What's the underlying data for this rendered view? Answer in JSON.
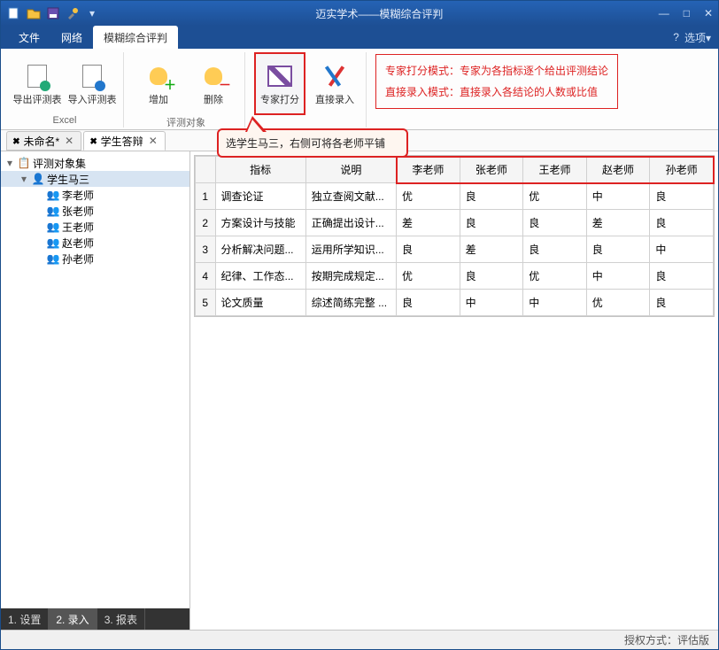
{
  "title": "迈实学术——模糊综合评判",
  "sysbuttons": {
    "min": "—",
    "max": "□",
    "close": "✕"
  },
  "menus": {
    "file": "文件",
    "net": "网络",
    "fuzzy": "模糊综合评判"
  },
  "right_menu": {
    "help": "?",
    "options": "选项▾"
  },
  "ribbon": {
    "excel": {
      "label": "Excel",
      "export": "导出评测表",
      "import": "导入评测表"
    },
    "subject": {
      "label": "评测对象",
      "add": "增加",
      "del": "删除"
    },
    "expert": "专家打分",
    "direct": "直接录入",
    "info_line1": "专家打分模式：专家为各指标逐个给出评测结论",
    "info_line2": "直接录入模式：直接录入各结论的人数或比值"
  },
  "callout_text": "选学生马三，右侧可将各老师平铺",
  "doctabs": {
    "tab1": "未命名*",
    "tab2": "学生答辩"
  },
  "tree": {
    "root": "评测对象集",
    "student": "学生马三",
    "teachers": [
      "李老师",
      "张老师",
      "王老师",
      "赵老师",
      "孙老师"
    ]
  },
  "subtabs": {
    "t1": "1. 设置",
    "t2": "2. 录入",
    "t3": "3. 报表"
  },
  "grid": {
    "headers": {
      "indicator": "指标",
      "desc": "说明"
    },
    "teachers": [
      "李老师",
      "张老师",
      "王老师",
      "赵老师",
      "孙老师"
    ],
    "rows": [
      {
        "n": "1",
        "ind": "调查论证",
        "desc": "独立查阅文献...",
        "v": [
          "优",
          "良",
          "优",
          "中",
          "良"
        ]
      },
      {
        "n": "2",
        "ind": "方案设计与技能",
        "desc": "正确提出设计...",
        "v": [
          "差",
          "良",
          "良",
          "差",
          "良"
        ]
      },
      {
        "n": "3",
        "ind": "分析解决问题...",
        "desc": "运用所学知识...",
        "v": [
          "良",
          "差",
          "良",
          "良",
          "中"
        ]
      },
      {
        "n": "4",
        "ind": "纪律、工作态...",
        "desc": "按期完成规定...",
        "v": [
          "优",
          "良",
          "优",
          "中",
          "良"
        ]
      },
      {
        "n": "5",
        "ind": "论文质量",
        "desc": "综述简练完整 ...",
        "v": [
          "良",
          "中",
          "中",
          "优",
          "良"
        ]
      }
    ]
  },
  "status": "授权方式：评估版"
}
